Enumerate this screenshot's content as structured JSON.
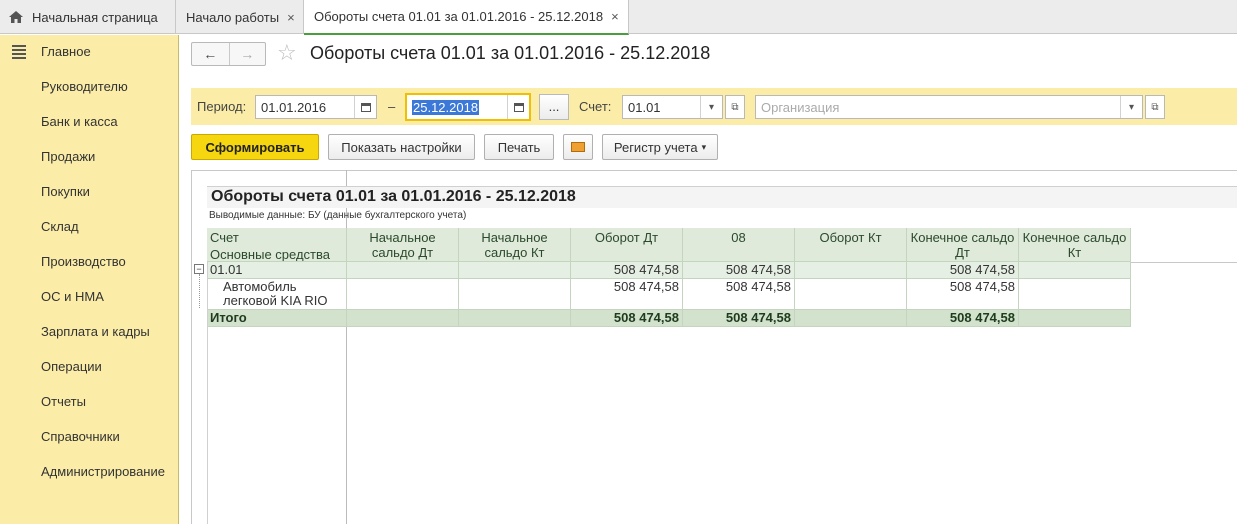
{
  "tabs": [
    {
      "label": "Начальная страница",
      "icon": "home-icon"
    },
    {
      "label": "Начало работы",
      "close": "×"
    },
    {
      "label": "Обороты счета 01.01 за 01.01.2016 - 25.12.2018",
      "close": "×"
    }
  ],
  "sidebar": {
    "menu_icon": "hamburger-menu-icon",
    "items": [
      "Главное",
      "Руководителю",
      "Банк и касса",
      "Продажи",
      "Покупки",
      "Склад",
      "Производство",
      "ОС и НМА",
      "Зарплата и кадры",
      "Операции",
      "Отчеты",
      "Справочники",
      "Администрирование"
    ]
  },
  "header": {
    "back_icon": "←",
    "forward_icon": "→",
    "favorite_icon": "☆",
    "title": "Обороты счета 01.01 за 01.01.2016 - 25.12.2018"
  },
  "params": {
    "period_label": "Период:",
    "date_from": "01.01.2016",
    "dash": "–",
    "date_to": "25.12.2018",
    "more_button": "...",
    "account_label": "Счет:",
    "account_value": "01.01",
    "organization_placeholder": "Организация"
  },
  "toolbar": {
    "generate": "Сформировать",
    "show_settings": "Показать настройки",
    "print": "Печать",
    "register": "Регистр учета"
  },
  "report": {
    "title": "Обороты счета 01.01 за 01.01.2016 - 25.12.2018",
    "subtitle": "Выводимые данные:  БУ (данные бухгалтерского учета)",
    "row_header_1": "Счет",
    "row_header_2": "Основные средства",
    "columns": [
      "Начальное сальдо Дт",
      "Начальное сальдо Кт",
      "Оборот Дт",
      "08",
      "Оборот Кт",
      "Конечное сальдо Дт",
      "Конечное сальдо Кт"
    ],
    "rows": [
      {
        "label": "01.01",
        "values": [
          "",
          "",
          "508 474,58",
          "508 474,58",
          "",
          "508 474,58",
          ""
        ]
      },
      {
        "label": "Автомобиль легковой KIA RIO",
        "values": [
          "",
          "",
          "508 474,58",
          "508 474,58",
          "",
          "508 474,58",
          ""
        ]
      },
      {
        "label": "Итого",
        "values": [
          "",
          "",
          "508 474,58",
          "508 474,58",
          "",
          "508 474,58",
          ""
        ]
      }
    ],
    "collapse_glyph": "−"
  }
}
